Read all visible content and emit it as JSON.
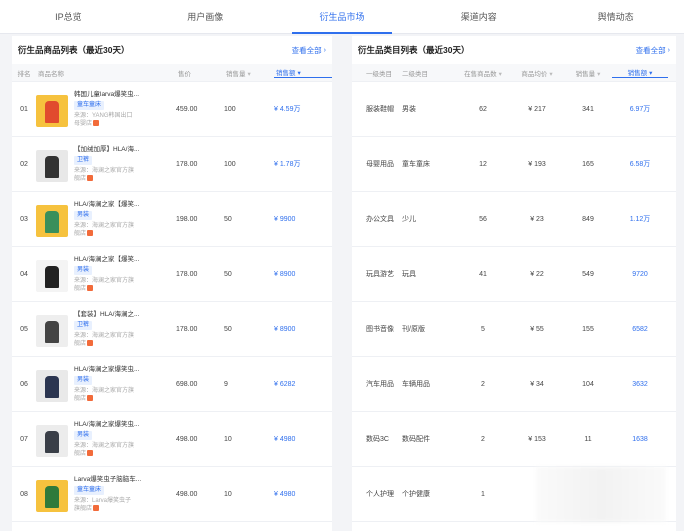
{
  "tabs": [
    {
      "label": "IP总览",
      "active": false
    },
    {
      "label": "用户画像",
      "active": false
    },
    {
      "label": "衍生品市场",
      "active": true
    },
    {
      "label": "渠道内容",
      "active": false
    },
    {
      "label": "舆情动态",
      "active": false
    }
  ],
  "accent_color": "#2f6fed",
  "left": {
    "title": "衍生品商品列表（最近30天）",
    "view_all": "查看全部",
    "columns": [
      "排名",
      "商品名称",
      "售价",
      "销售量",
      "销售额"
    ],
    "rows": [
      {
        "rank": "01",
        "name": "韩国儿童larva爆笑虫...",
        "tag": "童车童床",
        "source": "来源：YANG韩国出口",
        "source2": "母婴店",
        "price": "459.00",
        "sales": "100",
        "amount": "¥ 4.59万"
      },
      {
        "rank": "02",
        "name": "【加绒加厚】HLA/海...",
        "tag": "卫裤",
        "source": "来源：海澜之家官方旗",
        "source2": "舰店",
        "price": "178.00",
        "sales": "100",
        "amount": "¥ 1.78万"
      },
      {
        "rank": "03",
        "name": "HLA/海澜之家【爆笑...",
        "tag": "男装",
        "source": "来源：海澜之家官方旗",
        "source2": "舰店",
        "price": "198.00",
        "sales": "50",
        "amount": "¥ 9900"
      },
      {
        "rank": "04",
        "name": "HLA/海澜之家【爆笑...",
        "tag": "男装",
        "source": "来源：海澜之家官方旗",
        "source2": "舰店",
        "price": "178.00",
        "sales": "50",
        "amount": "¥ 8900"
      },
      {
        "rank": "05",
        "name": "【套装】HLA/海澜之...",
        "tag": "卫裤",
        "source": "来源：海澜之家官方旗",
        "source2": "舰店",
        "price": "178.00",
        "sales": "50",
        "amount": "¥ 8900"
      },
      {
        "rank": "06",
        "name": "HLA/海澜之家爆笑虫...",
        "tag": "男装",
        "source": "来源：海澜之家官方旗",
        "source2": "舰店",
        "price": "698.00",
        "sales": "9",
        "amount": "¥ 6282"
      },
      {
        "rank": "07",
        "name": "HLA/海澜之家爆笑虫...",
        "tag": "男装",
        "source": "来源：海澜之家官方旗",
        "source2": "舰店",
        "price": "498.00",
        "sales": "10",
        "amount": "¥ 4980"
      },
      {
        "rank": "08",
        "name": "Larva爆笑虫子脑脑车...",
        "tag": "童车童床",
        "source": "来源：Larva爆笑虫子",
        "source2": "旗舰店",
        "price": "498.00",
        "sales": "10",
        "amount": "¥ 4980"
      }
    ]
  },
  "right": {
    "title": "衍生品类目列表（最近30天）",
    "view_all": "查看全部",
    "columns": [
      "一级类目",
      "二级类目",
      "在售商品数",
      "商品均价",
      "销售量",
      "销售额"
    ],
    "rows": [
      {
        "c1": "服装鞋帽",
        "c2": "男装",
        "count": "62",
        "avg": "¥ 217",
        "sales": "341",
        "amount": "6.97万"
      },
      {
        "c1": "母婴用品",
        "c2": "童车童床",
        "count": "12",
        "avg": "¥ 193",
        "sales": "165",
        "amount": "6.58万"
      },
      {
        "c1": "办公文具",
        "c2": "少儿",
        "count": "56",
        "avg": "¥ 23",
        "sales": "849",
        "amount": "1.12万"
      },
      {
        "c1": "玩具游艺",
        "c2": "玩具",
        "count": "41",
        "avg": "¥ 22",
        "sales": "549",
        "amount": "9720"
      },
      {
        "c1": "图书音像",
        "c2": "刊/原版",
        "count": "5",
        "avg": "¥ 55",
        "sales": "155",
        "amount": "6582"
      },
      {
        "c1": "汽车用品",
        "c2": "车辆用品",
        "count": "2",
        "avg": "¥ 34",
        "sales": "104",
        "amount": "3632"
      },
      {
        "c1": "数码3C",
        "c2": "数码配件",
        "count": "2",
        "avg": "¥ 153",
        "sales": "11",
        "amount": "1638"
      },
      {
        "c1": "个人护理",
        "c2": "个护健康",
        "count": "1",
        "avg": "",
        "sales": "",
        "amount": ""
      }
    ]
  }
}
